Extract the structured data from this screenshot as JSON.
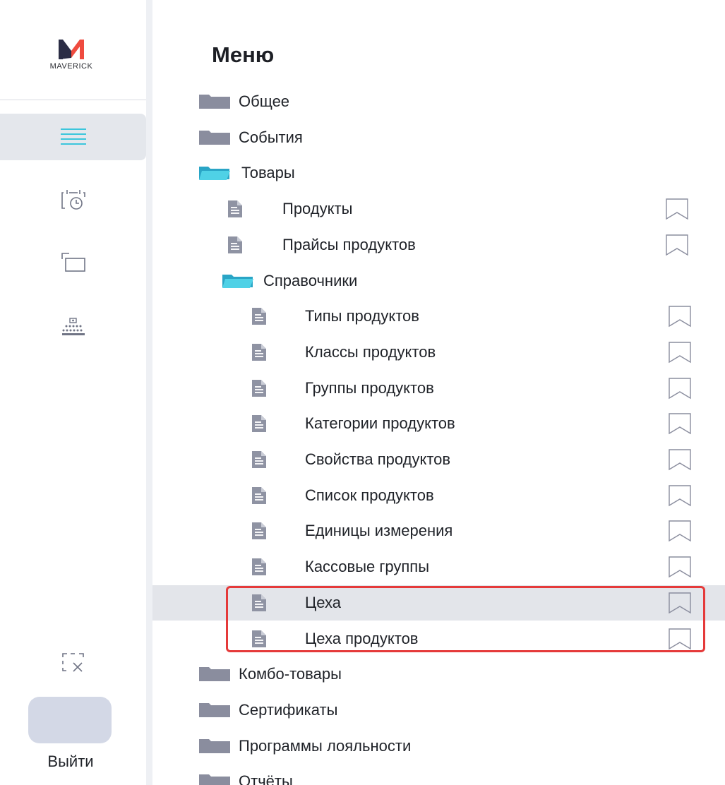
{
  "logo": {
    "text": "MAVERICK"
  },
  "rail": {
    "items": [
      {
        "icon": "menu-list-icon",
        "active": true
      },
      {
        "icon": "calendar-clock-icon",
        "active": false
      },
      {
        "icon": "windows-icon",
        "active": false
      },
      {
        "icon": "org-structure-icon",
        "active": false
      }
    ],
    "close_icon": "close-selection-icon",
    "logout_label": "Выйти"
  },
  "menu": {
    "title": "Меню",
    "items": [
      {
        "label": "Общее",
        "type": "folder",
        "open": false
      },
      {
        "label": "События",
        "type": "folder",
        "open": false
      },
      {
        "label": "Товары",
        "type": "folder",
        "open": true
      },
      {
        "label": "Продукты",
        "type": "doc"
      },
      {
        "label": "Прайсы продуктов",
        "type": "doc"
      },
      {
        "label": "Справочники",
        "type": "folder",
        "open": true
      },
      {
        "label": "Типы продуктов",
        "type": "doc"
      },
      {
        "label": "Классы продуктов",
        "type": "doc"
      },
      {
        "label": "Группы продуктов",
        "type": "doc"
      },
      {
        "label": "Категории продуктов",
        "type": "doc"
      },
      {
        "label": "Свойства продуктов",
        "type": "doc"
      },
      {
        "label": "Список продуктов",
        "type": "doc"
      },
      {
        "label": "Единицы измерения",
        "type": "doc"
      },
      {
        "label": "Кассовые группы",
        "type": "doc"
      },
      {
        "label": "Цеха",
        "type": "doc",
        "selected": true
      },
      {
        "label": "Цеха продуктов",
        "type": "doc"
      },
      {
        "label": "Комбо-товары",
        "type": "folder",
        "open": false
      },
      {
        "label": "Сертификаты",
        "type": "folder",
        "open": false
      },
      {
        "label": "Программы лояльности",
        "type": "folder",
        "open": false
      },
      {
        "label": "Отчёты",
        "type": "folder",
        "open": false
      }
    ]
  },
  "colors": {
    "accent": "#3cc6dc",
    "folder_closed": "#8a8d9e",
    "doc_icon": "#8f93a3",
    "highlight": "#e53a3a",
    "selected_row": "#e3e5ea",
    "logo_red": "#ef4b3f",
    "logo_dark": "#2b2d45"
  }
}
